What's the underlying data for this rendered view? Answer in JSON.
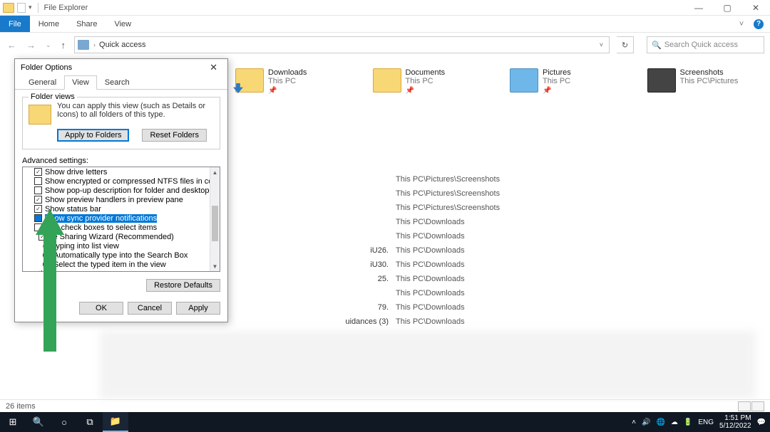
{
  "window": {
    "title": "File Explorer",
    "quick_drop": "▾"
  },
  "ribbon": {
    "file": "File",
    "tabs": [
      "Home",
      "Share",
      "View"
    ],
    "chevron": "˅"
  },
  "nav": {
    "back": "←",
    "forward": "→",
    "dropdown": "⌄",
    "up": "↑",
    "crumbs": [
      "Quick access"
    ],
    "address_drop": "˅",
    "refresh": "↻",
    "search_placeholder": "Search Quick access",
    "search_icon": "🔍"
  },
  "folders": [
    {
      "name": "Downloads",
      "loc": "This PC",
      "pinned": true,
      "style": "downloads"
    },
    {
      "name": "Documents",
      "loc": "This PC",
      "pinned": true,
      "style": "documents"
    },
    {
      "name": "Pictures",
      "loc": "This PC",
      "pinned": true,
      "style": "pictures"
    },
    {
      "name": "Screenshots",
      "loc": "This PC\\Pictures",
      "pinned": false,
      "style": "screenshots"
    }
  ],
  "files": [
    {
      "name": "",
      "loc": "This PC\\Pictures\\Screenshots"
    },
    {
      "name": "",
      "loc": "This PC\\Pictures\\Screenshots"
    },
    {
      "name": "",
      "loc": "This PC\\Pictures\\Screenshots"
    },
    {
      "name": "",
      "loc": "This PC\\Downloads"
    },
    {
      "name": "",
      "loc": "This PC\\Downloads"
    },
    {
      "name": "iU26.",
      "loc": "This PC\\Downloads"
    },
    {
      "name": "iU30.",
      "loc": "This PC\\Downloads"
    },
    {
      "name": "25.",
      "loc": "This PC\\Downloads"
    },
    {
      "name": "",
      "loc": "This PC\\Downloads"
    },
    {
      "name": "79.",
      "loc": "This PC\\Downloads"
    },
    {
      "name": "uidances (3)",
      "loc": "This PC\\Downloads"
    }
  ],
  "status": {
    "items_text": "26 items"
  },
  "dialog": {
    "title": "Folder Options",
    "close": "✕",
    "tabs": {
      "general": "General",
      "view": "View",
      "search": "Search"
    },
    "selected_tab": "view",
    "folder_views": {
      "legend": "Folder views",
      "desc": "You can apply this view (such as Details or Icons) to all folders of this type.",
      "apply": "Apply to Folders",
      "reset": "Reset Folders"
    },
    "advanced_label": "Advanced settings:",
    "advanced": [
      {
        "kind": "cb",
        "checked": true,
        "label": "Show drive letters",
        "selected": false
      },
      {
        "kind": "cb",
        "checked": false,
        "label": "Show encrypted or compressed NTFS files in color",
        "selected": false
      },
      {
        "kind": "cb",
        "checked": false,
        "label": "Show pop-up description for folder and desktop items",
        "selected": false
      },
      {
        "kind": "cb",
        "checked": true,
        "label": "Show preview handlers in preview pane",
        "selected": false
      },
      {
        "kind": "cb",
        "checked": true,
        "label": "Show status bar",
        "selected": false
      },
      {
        "kind": "cb",
        "checked": false,
        "label": "Show sync provider notifications",
        "selected": true
      },
      {
        "kind": "cb",
        "checked": false,
        "label": "Use check boxes to select items",
        "selected": false
      },
      {
        "kind": "cb_partial",
        "checked": true,
        "label": "se Sharing Wizard (Recommended)",
        "selected": false
      },
      {
        "kind": "text",
        "label": "en typing into list view",
        "selected": false
      },
      {
        "kind": "radio",
        "checked": false,
        "label": "Automatically type into the Search Box",
        "selected": false
      },
      {
        "kind": "radio",
        "checked": true,
        "label": "Select the typed item in the view",
        "selected": false
      },
      {
        "kind": "text_partial",
        "label": "ation pane",
        "selected": false
      }
    ],
    "restore": "Restore Defaults",
    "ok": "OK",
    "cancel": "Cancel",
    "apply": "Apply"
  },
  "taskbar": {
    "lang": "ENG",
    "time": "1:51 PM",
    "date": "5/12/2022"
  }
}
